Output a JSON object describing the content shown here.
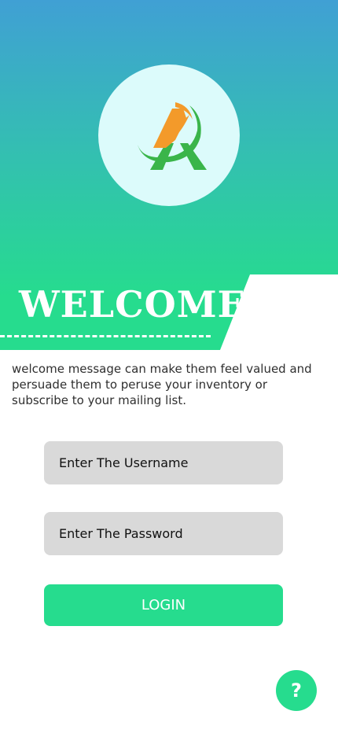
{
  "header": {
    "title": "WELCOME",
    "logo_icon": "A-logo-icon"
  },
  "colors": {
    "gradient_top": "#40a0d4",
    "gradient_bottom": "#26dc8e",
    "accent": "#26dc8e",
    "logo_orange": "#f39a2a",
    "logo_green": "#3ab54a",
    "logo_circle": "#dcfbfb"
  },
  "description": "welcome message can make them feel valued and persuade them to peruse your inventory or subscribe to your mailing list.",
  "form": {
    "username_placeholder": "Enter The Username",
    "password_placeholder": "Enter The Password",
    "login_label": "LOGIN"
  },
  "help": {
    "label": "?",
    "icon": "question-icon"
  }
}
